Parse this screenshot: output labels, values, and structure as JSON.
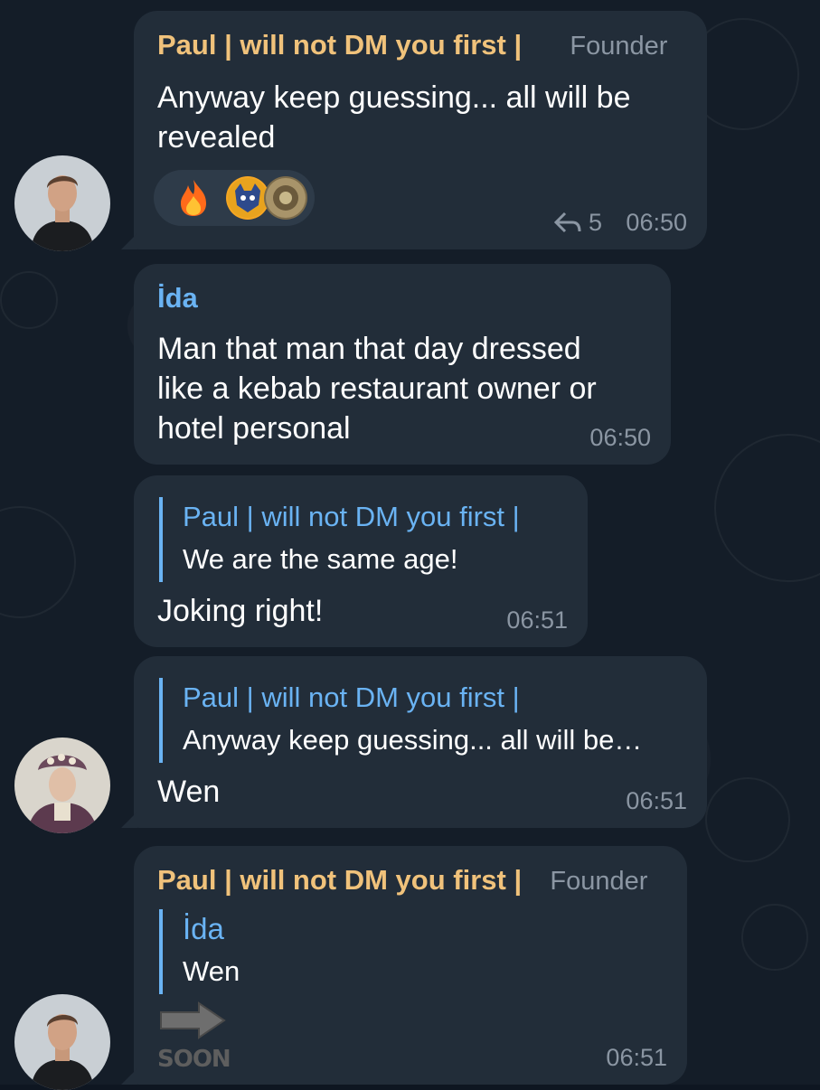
{
  "messages": [
    {
      "sender": "Paul | will not DM you first |",
      "role": "Founder",
      "text_line1": "Anyway keep guessing... all will be",
      "text_line2": "revealed",
      "reactions": [
        "🔥",
        "🦇",
        "🐱"
      ],
      "reply_count": "5",
      "time": "06:50"
    },
    {
      "sender": "İda",
      "text_line1": "Man that man that day dressed",
      "text_line2": "like a kebab restaurant owner or",
      "text_line3": "hotel personal",
      "time": "06:50"
    },
    {
      "quote_name": "Paul | will not DM you first |",
      "quote_text": "We are the same age!",
      "text": "Joking right!",
      "time": "06:51"
    },
    {
      "quote_name": "Paul | will not DM you first |",
      "quote_text": "Anyway keep guessing... all will be…",
      "text": "Wen",
      "time": "06:51"
    },
    {
      "sender": "Paul | will not DM you first |",
      "role": "Founder",
      "quote_name": "İda",
      "quote_text": "Wen",
      "sticker_text": "SOON",
      "time": "06:51"
    }
  ],
  "colors": {
    "background": "#141d28",
    "bubble": "#222d39",
    "founder_name": "#f0c27b",
    "link_blue": "#6ab3f3",
    "meta_gray": "#8b96a3"
  },
  "icons": [
    "reply-arrow-icon",
    "fire-emoji-icon",
    "arrow-sticker-icon"
  ]
}
